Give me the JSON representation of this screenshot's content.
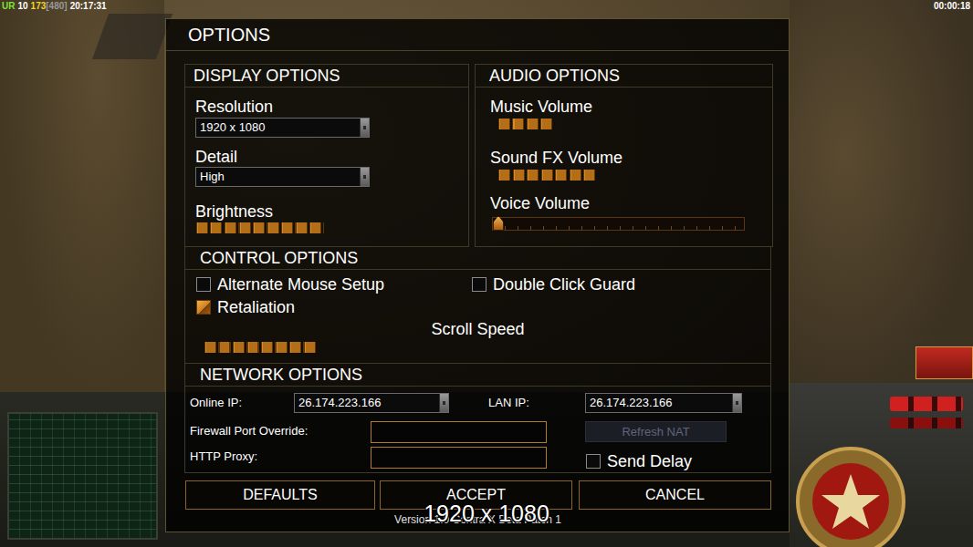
{
  "hud": {
    "stats": [
      {
        "text": "UR",
        "color": "#7ee03a"
      },
      {
        "text": "10",
        "color": "#ffffff"
      },
      {
        "text": "173",
        "color": "#f2d22e"
      },
      {
        "text": "[480]",
        "color": "#9a9a9a"
      },
      {
        "text": "20:17:31",
        "color": "#ffffff"
      }
    ],
    "timer": "00:00:18"
  },
  "dialog": {
    "title": "OPTIONS",
    "display": {
      "header": "DISPLAY OPTIONS",
      "resolution": {
        "label": "Resolution",
        "value": "1920 x 1080"
      },
      "detail": {
        "label": "Detail",
        "value": "High"
      },
      "brightness": {
        "label": "Brightness",
        "level": 0.5
      }
    },
    "audio": {
      "header": "AUDIO OPTIONS",
      "sliders": [
        {
          "label": "Music Volume",
          "kind": "bar",
          "level": 0.21
        },
        {
          "label": "Sound FX Volume",
          "kind": "bar",
          "level": 0.39
        },
        {
          "label": "Voice Volume",
          "kind": "track",
          "level": 0
        }
      ]
    },
    "controls": {
      "header": "CONTROL OPTIONS",
      "checkboxes": [
        {
          "label": "Alternate Mouse Setup",
          "checked": false
        },
        {
          "label": "Double Click Guard",
          "checked": false
        },
        {
          "label": "Retaliation",
          "checked": true
        }
      ],
      "scroll_speed": {
        "label": "Scroll Speed",
        "level": 0.44
      }
    },
    "network": {
      "header": "NETWORK OPTIONS",
      "online_ip": {
        "label": "Online IP:",
        "value": "26.174.223.166"
      },
      "lan_ip": {
        "label": "LAN IP:",
        "value": "26.174.223.166"
      },
      "firewall_port_override": {
        "label": "Firewall Port Override:",
        "value": ""
      },
      "http_proxy": {
        "label": "HTTP Proxy:",
        "value": ""
      },
      "refresh_nat": {
        "label": "Refresh NAT",
        "disabled": true
      },
      "send_delay": {
        "label": "Send Delay",
        "checked": false
      }
    },
    "buttons": [
      "DEFAULTS",
      "ACCEPT",
      "CANCEL"
    ],
    "version": "Version 1.0 Contra X Beta Patch 1"
  },
  "overlay": {
    "text": "1920 x 1080"
  }
}
